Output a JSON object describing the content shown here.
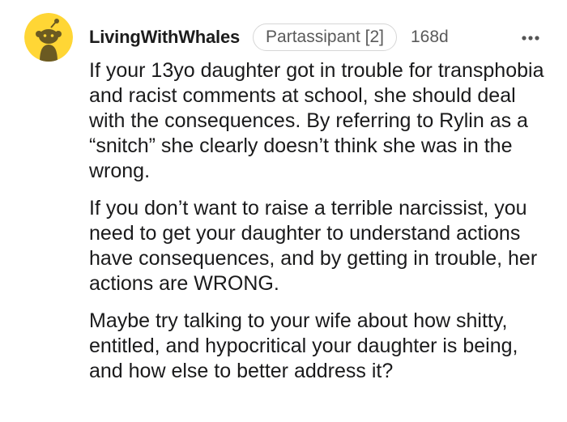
{
  "comment": {
    "username": "LivingWithWhales",
    "flair": "Partassipant [2]",
    "age": "168d",
    "avatar_icon": "reddit-snoo-avatar-icon",
    "more_icon": "more-options-icon",
    "colors": {
      "avatar_bg": "#ffd635",
      "avatar_snoo": "#6b5a22"
    },
    "paragraphs": [
      "If your 13yo daughter got in trouble for transphobia and racist comments at school, she should deal with the consequences. By referring to Rylin as a “snitch” she clearly doesn’t think she was in the wrong.",
      "If you don’t want to raise a terrible narcissist, you need to get your daughter to understand actions have consequences, and by getting in trouble, her actions are WRONG.",
      "Maybe try talking to your wife about how shitty, entitled, and hypocritical your daughter is being, and how else to better address it?"
    ]
  }
}
